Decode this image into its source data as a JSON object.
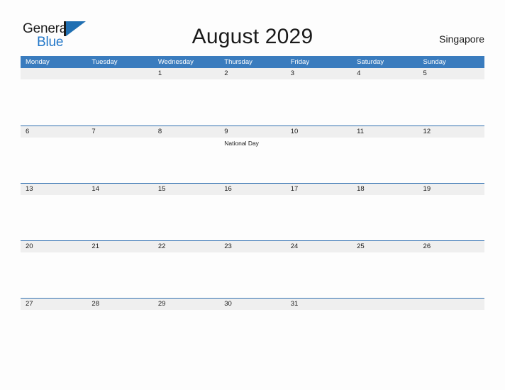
{
  "brand": {
    "name_part1": "General",
    "name_part2": "Blue",
    "mark": "triangle-flag-icon",
    "colors": {
      "dark": "#1b1b1b",
      "blue": "#2277c8",
      "mark_blue": "#1f6fb2"
    }
  },
  "header": {
    "title": "August 2029",
    "location": "Singapore"
  },
  "theme": {
    "header_blue": "#3a7cbe",
    "separator_blue": "#2f6fb0",
    "band_gray": "#efefef",
    "page_background": "#fdfdfd",
    "text": "#1a1a1a"
  },
  "calendar": {
    "weekdays": [
      "Monday",
      "Tuesday",
      "Wednesday",
      "Thursday",
      "Friday",
      "Saturday",
      "Sunday"
    ],
    "weeks": [
      [
        {
          "num": "",
          "events": []
        },
        {
          "num": "",
          "events": []
        },
        {
          "num": "1",
          "events": []
        },
        {
          "num": "2",
          "events": []
        },
        {
          "num": "3",
          "events": []
        },
        {
          "num": "4",
          "events": []
        },
        {
          "num": "5",
          "events": []
        }
      ],
      [
        {
          "num": "6",
          "events": []
        },
        {
          "num": "7",
          "events": []
        },
        {
          "num": "8",
          "events": []
        },
        {
          "num": "9",
          "events": [
            "National Day"
          ]
        },
        {
          "num": "10",
          "events": []
        },
        {
          "num": "11",
          "events": []
        },
        {
          "num": "12",
          "events": []
        }
      ],
      [
        {
          "num": "13",
          "events": []
        },
        {
          "num": "14",
          "events": []
        },
        {
          "num": "15",
          "events": []
        },
        {
          "num": "16",
          "events": []
        },
        {
          "num": "17",
          "events": []
        },
        {
          "num": "18",
          "events": []
        },
        {
          "num": "19",
          "events": []
        }
      ],
      [
        {
          "num": "20",
          "events": []
        },
        {
          "num": "21",
          "events": []
        },
        {
          "num": "22",
          "events": []
        },
        {
          "num": "23",
          "events": []
        },
        {
          "num": "24",
          "events": []
        },
        {
          "num": "25",
          "events": []
        },
        {
          "num": "26",
          "events": []
        }
      ],
      [
        {
          "num": "27",
          "events": []
        },
        {
          "num": "28",
          "events": []
        },
        {
          "num": "29",
          "events": []
        },
        {
          "num": "30",
          "events": []
        },
        {
          "num": "31",
          "events": []
        },
        {
          "num": "",
          "events": []
        },
        {
          "num": "",
          "events": []
        }
      ]
    ]
  }
}
